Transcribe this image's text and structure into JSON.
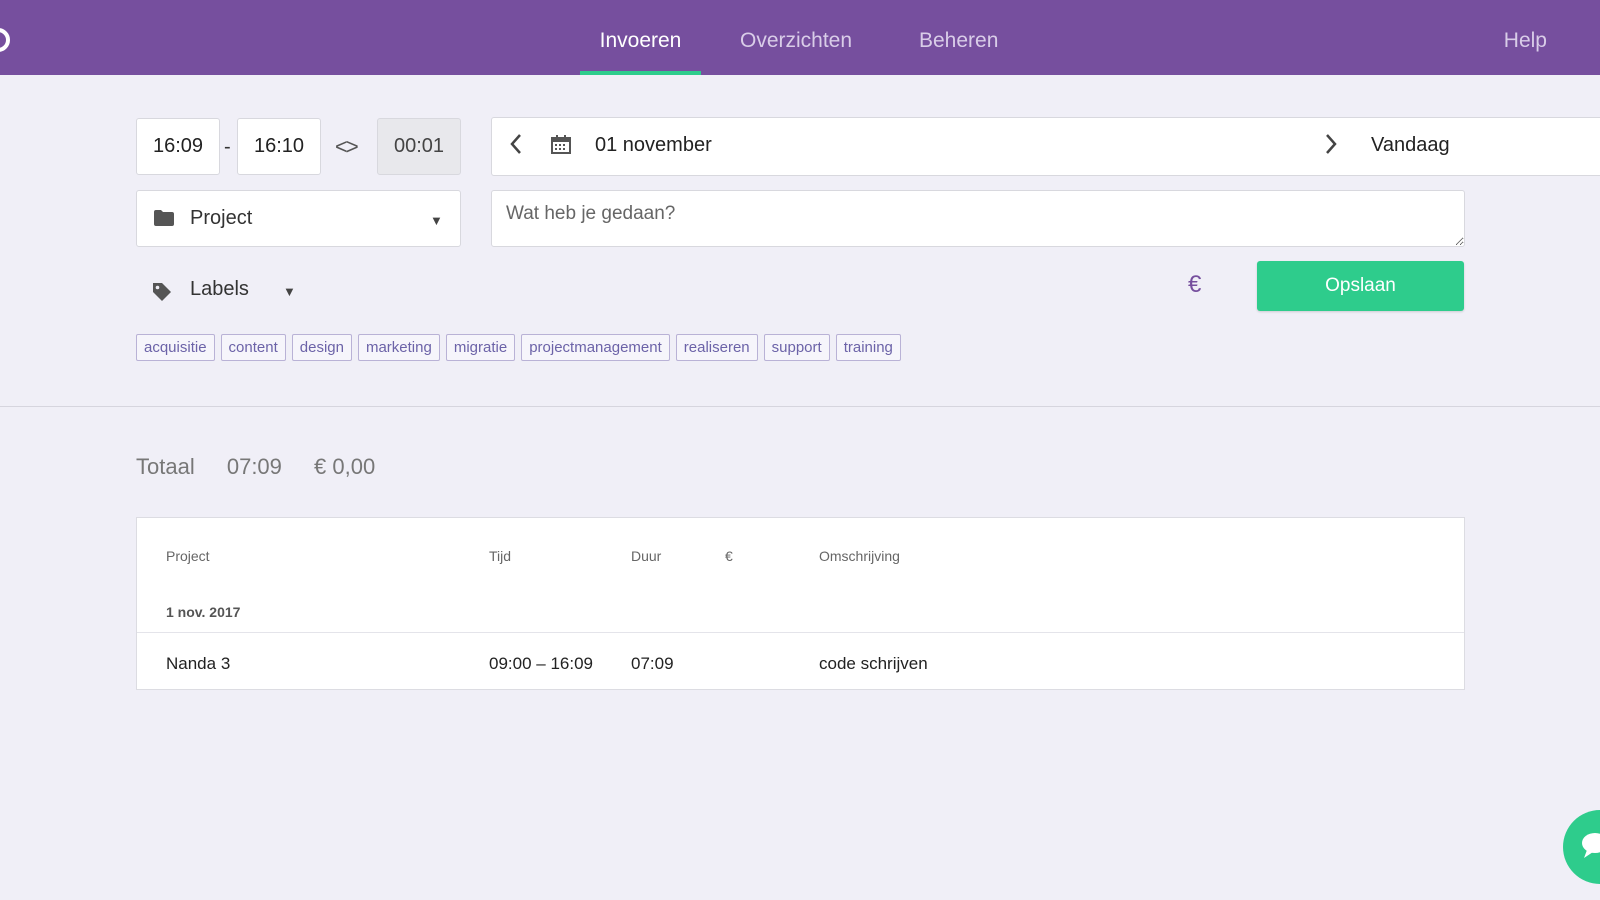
{
  "nav": {
    "tabs": [
      {
        "label": "Invoeren",
        "active": true
      },
      {
        "label": "Overzichten",
        "active": false
      },
      {
        "label": "Beheren",
        "active": false
      }
    ],
    "help": "Help"
  },
  "entry": {
    "start_time": "16:09",
    "separator": "-",
    "end_time": "16:10",
    "duration": "00:01",
    "date": "01 november",
    "today_label": "Vandaag",
    "project_label": "Project",
    "description_placeholder": "Wat heb je gedaan?",
    "labels_label": "Labels",
    "rate_symbol": "€",
    "save_label": "Opslaan",
    "tags": [
      "acquisitie",
      "content",
      "design",
      "marketing",
      "migratie",
      "projectmanagement",
      "realiseren",
      "support",
      "training"
    ]
  },
  "totals": {
    "label": "Totaal",
    "time": "07:09",
    "amount": "€ 0,00"
  },
  "table": {
    "headers": {
      "project": "Project",
      "time": "Tijd",
      "duration": "Duur",
      "amount": "€",
      "description": "Omschrijving"
    },
    "group_date": "1 nov. 2017",
    "rows": [
      {
        "project": "Nanda 3",
        "time": "09:00 – 16:09",
        "duration": "07:09",
        "amount": "",
        "description": "code schrijven"
      }
    ]
  },
  "colors": {
    "brand": "#764f9e",
    "accent": "#2ecc8c",
    "background": "#f0eff7"
  },
  "icons": [
    "logo-icon",
    "swap-icon",
    "chevron-left-icon",
    "calendar-icon",
    "chevron-right-icon",
    "folder-icon",
    "caret-down-icon",
    "tag-icon",
    "euro-icon",
    "chat-icon"
  ]
}
